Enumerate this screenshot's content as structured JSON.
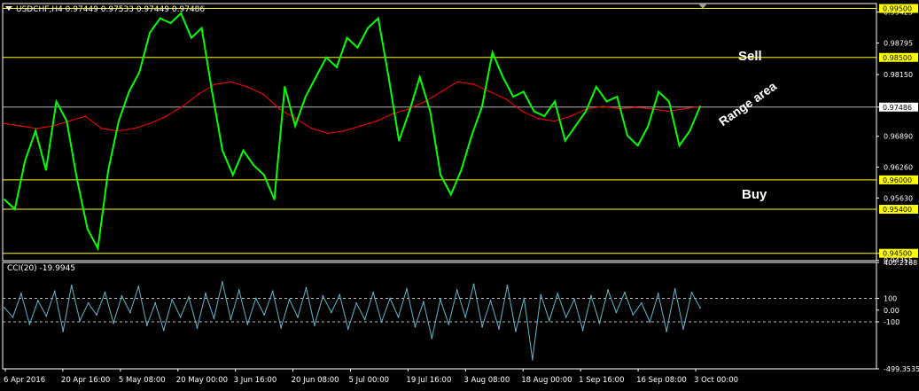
{
  "header": {
    "symbol_info": "USDCHF,H4  0.97449 0.97533 0.97449 0.97486"
  },
  "indicator": {
    "title": "CCI(20) -19.9945"
  },
  "annotations": {
    "sell": "Sell",
    "buy": "Buy",
    "range": "Range area"
  },
  "colors": {
    "background": "#000000",
    "price": "#00ff00",
    "ma": "#ff0000",
    "level": "#ffff00",
    "cci": "#5fb6c9",
    "axis": "#ffffff"
  },
  "chart_data": [
    {
      "type": "line",
      "x_ticks": [
        "6 Apr 2016",
        "20 Apr 16:00",
        "5 May 08:00",
        "20 May 00:00",
        "3 Jun 16:00",
        "20 Jun 08:00",
        "5 Jul 00:00",
        "19 Jul 16:00",
        "3 Aug 08:00",
        "18 Aug 00:00",
        "1 Sep 16:00",
        "16 Sep 08:00",
        "3 Oct 00:00"
      ],
      "y_ticks": [
        "0.99425",
        "0.98795",
        "0.98150",
        "0.97486",
        "0.96890",
        "0.96260",
        "0.95630",
        "0.94500",
        "0.94355"
      ],
      "levels": [
        {
          "value": 0.995,
          "label": "0.99500"
        },
        {
          "value": 0.985,
          "label": "0.98500"
        },
        {
          "value": 0.96,
          "label": "0.96000"
        },
        {
          "value": 0.954,
          "label": "0.95400"
        },
        {
          "value": 0.945,
          "label": "0.94500"
        }
      ],
      "current_price": {
        "value": 0.97486,
        "label": "0.97486"
      },
      "ylim": [
        0.9435,
        0.996
      ],
      "series": [
        {
          "values": [
            0.956,
            0.954,
            0.964,
            0.97,
            0.962,
            0.976,
            0.972,
            0.96,
            0.95,
            0.946,
            0.962,
            0.972,
            0.978,
            0.982,
            0.99,
            0.993,
            0.992,
            0.994,
            0.989,
            0.991,
            0.978,
            0.966,
            0.961,
            0.966,
            0.963,
            0.961,
            0.956,
            0.979,
            0.971,
            0.977,
            0.981,
            0.985,
            0.983,
            0.989,
            0.987,
            0.991,
            0.993,
            0.981,
            0.968,
            0.974,
            0.981,
            0.974,
            0.961,
            0.957,
            0.962,
            0.969,
            0.975,
            0.986,
            0.981,
            0.977,
            0.978,
            0.974,
            0.973,
            0.976,
            0.968,
            0.971,
            0.974,
            0.979,
            0.976,
            0.977,
            0.969,
            0.967,
            0.971,
            0.978,
            0.976,
            0.967,
            0.97,
            0.975
          ]
        },
        {
          "values": [
            0.9715,
            0.971,
            0.9705,
            0.971,
            0.972,
            0.973,
            0.9705,
            0.97,
            0.9705,
            0.9715,
            0.973,
            0.975,
            0.9775,
            0.9795,
            0.98,
            0.979,
            0.9775,
            0.9745,
            0.9725,
            0.9705,
            0.9695,
            0.97,
            0.971,
            0.972,
            0.9735,
            0.9745,
            0.976,
            0.978,
            0.98,
            0.9795,
            0.978,
            0.9765,
            0.974,
            0.9725,
            0.972,
            0.973,
            0.9745,
            0.975,
            0.9745,
            0.9748,
            0.9745,
            0.974,
            0.9745,
            0.975
          ]
        }
      ]
    },
    {
      "type": "line",
      "y_ticks": [
        "405.2168",
        "100",
        "0.00",
        "-100",
        "-499.3535"
      ],
      "ylim": [
        -499.3535,
        405.2168
      ],
      "reference_lines": [
        100,
        -100
      ],
      "series": [
        {
          "values": [
            20,
            -60,
            140,
            -120,
            80,
            -50,
            160,
            -180,
            210,
            -90,
            60,
            -40,
            150,
            -110,
            120,
            -20,
            200,
            -130,
            60,
            -170,
            90,
            -60,
            110,
            -150,
            140,
            -70,
            240,
            -80,
            170,
            -120,
            100,
            -40,
            160,
            -150,
            90,
            -60,
            190,
            -130,
            120,
            -20,
            130,
            -160,
            60,
            -80,
            150,
            -100,
            100,
            -60,
            180,
            -140,
            70,
            -240,
            90,
            -120,
            170,
            -60,
            220,
            -140,
            80,
            -160,
            210,
            -180,
            100,
            -420,
            130,
            -90,
            140,
            -60,
            90,
            -170,
            120,
            -110,
            170,
            -20,
            150,
            -40,
            60,
            -100,
            140,
            -180,
            180,
            -160,
            150,
            20
          ]
        }
      ]
    }
  ]
}
